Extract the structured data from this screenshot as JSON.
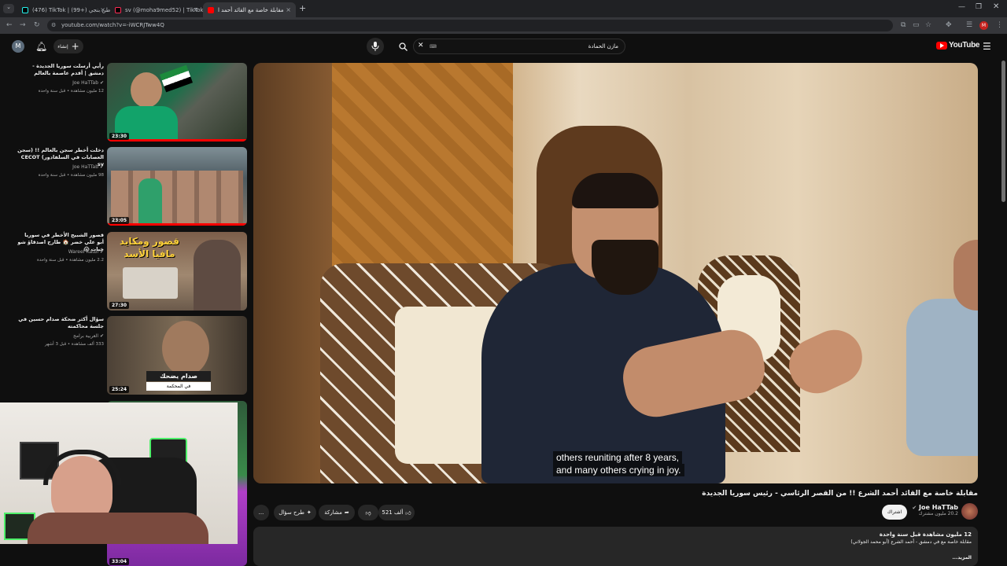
{
  "browser": {
    "tabs": [
      {
        "label": "(476) TikTok | وطن بنجي (+99)",
        "active": false
      },
      {
        "label": "sv (@moha9med52) | TikTok",
        "active": false
      },
      {
        "label": "مقابلة خاصة مع القائد أحمد ا",
        "active": true
      }
    ],
    "url": "youtube.com/watch?v=-iWCRJTww4Q",
    "new_tab": "+"
  },
  "header": {
    "logo": "YouTube",
    "search_value": "مازن الحمادة",
    "create_label": "إنشاء",
    "avatar_letter": "M"
  },
  "recommendations": [
    {
      "title": "رأيي أرسلت سوريا الجديدة - دمشق | أقدم عاصمة بالعالم",
      "channel": "Joe HaTTab",
      "meta": "12 مليون مشاهدة • قبل سنة واحدة",
      "duration": "23:30"
    },
    {
      "title": "دخلت أخطر سجن بالعالم !! (سجن العصابات في السلفادور) CECOT sv",
      "channel": "Joe HaTTab",
      "meta": "98 مليون مشاهدة • قبل سنة واحدة",
      "duration": "23:05"
    },
    {
      "title": "قصور الشبيح الأخطر في سوريا أبو علي خضر 🏠 طارح اصدقاؤ شو خبات 😱",
      "channel": "Wareef Katbi",
      "meta": "2.2 مليون مشاهدة • قبل سنة واحدة",
      "duration": "27:30",
      "overlay": "قصور ومكايد مافيا الأسد"
    },
    {
      "title": "سؤال أكثر ضحكة صدام حسين في جلسة محاكمته",
      "channel": "العربية برامج",
      "meta": "333 ألف مشاهدة • قبل 3 أشهر",
      "duration": "25:24",
      "overlay": "صدام يضحك",
      "overlay_sub": "في المحكمة"
    },
    {
      "duration": "33:04"
    }
  ],
  "video": {
    "caption_line1": "others reuniting after 8 years,",
    "caption_line2": "and many others crying in joy.",
    "title": "مقابلة خاصة مع القائد أحمد الشرع !! من القصر الرئاسي - رئيس سوريا الجديدة",
    "channel": "Joe HaTTab",
    "subscribers": "20.2 مليون مشترك",
    "subscribed_label": "اشتراك",
    "likes": "521 ألف",
    "share_label": "مشاركة",
    "ask_label": "طرح سؤال",
    "more_label": "...",
    "desc_views": "12 مليون مشاهدة  قبل سنة واحدة",
    "desc_line": "مقابلة خاصة مع في دمشق - أحمد الشرع  (أبو محمد الجولاني)",
    "desc_more": "...المزيد"
  },
  "colors": {
    "bg": "#0f0f0f",
    "red": "#ff0000",
    "pill": "#272727"
  }
}
